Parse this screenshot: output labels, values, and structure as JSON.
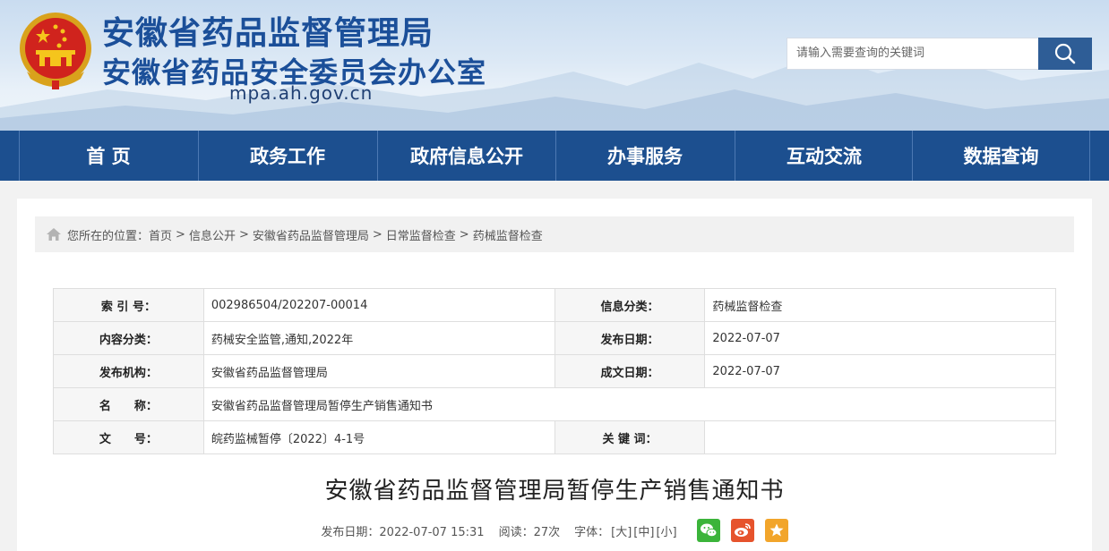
{
  "header": {
    "title_main": "安徽省药品监督管理局",
    "title_sub": "安徽省药品安全委员会办公室",
    "domain": "mpa.ah.gov.cn",
    "search_placeholder": "请输入需要查询的关键词"
  },
  "nav": {
    "items": [
      "首 页",
      "政务工作",
      "政府信息公开",
      "办事服务",
      "互动交流",
      "数据查询"
    ]
  },
  "breadcrumb": {
    "prefix": "您所在的位置：",
    "items": [
      "首页",
      "信息公开",
      "安徽省药品监督管理局",
      "日常监督检查",
      "药械监督检查"
    ],
    "separator": ">"
  },
  "meta_table": {
    "index_label": "索 引 号：",
    "index_value": "002986504/202207-00014",
    "category_label": "信息分类：",
    "category_value": "药械监督检查",
    "content_type_label": "内容分类：",
    "content_type_value": "药械安全监管,通知,2022年",
    "publish_date_label": "发布日期：",
    "publish_date_value": "2022-07-07",
    "publisher_label": "发布机构：",
    "publisher_value": "安徽省药品监督管理局",
    "created_date_label": "成文日期：",
    "created_date_value": "2022-07-07",
    "name_label": "名　　称：",
    "name_value": "安徽省药品监督管理局暂停生产销售通知书",
    "doc_no_label": "文　　号：",
    "doc_no_value": "皖药监械暂停〔2022〕4-1号",
    "keywords_label": "关 键 词：",
    "keywords_value": ""
  },
  "article": {
    "title": "安徽省药品监督管理局暂停生产销售通知书",
    "publish_time": "发布日期：2022-07-07 15:31",
    "views": "阅读：27次",
    "font_label": "字体：",
    "font_large": "[大]",
    "font_medium": "[中]",
    "font_small": "[小]"
  },
  "colors": {
    "brand_blue": "#1b4f99",
    "nav_bg": "#1c4f8f",
    "wechat": "#3bb43a",
    "weibo": "#e6532c",
    "favorite": "#f2a52b"
  },
  "icons": [
    "national-emblem-icon",
    "search-icon",
    "home-icon",
    "wechat-icon",
    "weibo-icon",
    "favorite-icon"
  ]
}
